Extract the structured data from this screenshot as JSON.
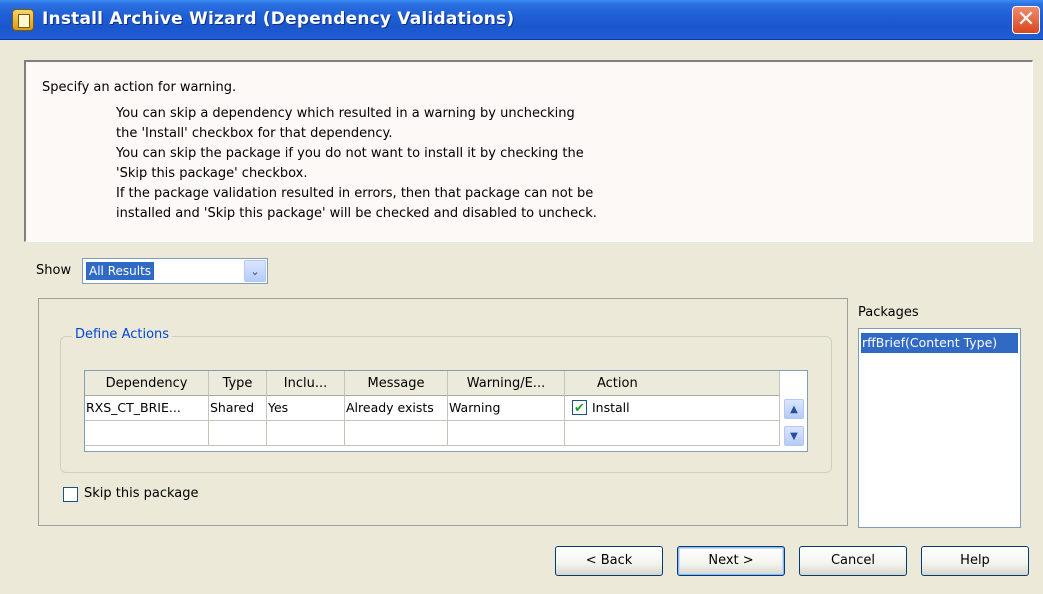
{
  "window": {
    "title": "Install Archive Wizard (Dependency Validations)",
    "close_glyph": "✕",
    "icon": "archive-wizard-icon"
  },
  "instructions": {
    "heading": "Specify an action for warning.",
    "lines": [
      "You can skip a dependency which resulted in a warning by unchecking",
      "the 'Install' checkbox for that dependency.",
      "You can skip the package if you do not want to install it by checking the",
      "'Skip this package' checkbox.",
      "If the package validation resulted in errors, then that package can not be",
      "installed and 'Skip this package' will be checked and disabled to uncheck."
    ]
  },
  "show": {
    "label": "Show",
    "selected": "All Results"
  },
  "define_actions": {
    "legend": "Define Actions",
    "columns": [
      "Dependency",
      "Type",
      "Inclu...",
      "Message",
      "Warning/E...",
      "Action"
    ],
    "rows": [
      {
        "dependency": "RXS_CT_BRIE...",
        "type": "Shared",
        "included": "Yes",
        "message": "Already exists",
        "warning": "Warning",
        "action_checked": true,
        "action_label": "Install"
      }
    ]
  },
  "skip_package": {
    "label": "Skip this package",
    "checked": false
  },
  "packages": {
    "label": "Packages",
    "items": [
      "rffBrief(Content Type)"
    ],
    "selected_index": 0
  },
  "buttons": {
    "back": "< Back",
    "next": "Next >",
    "cancel": "Cancel",
    "help": "Help"
  },
  "glyphs": {
    "chevron_down": "⌄",
    "scroll_up": "▲",
    "scroll_down": "▼",
    "check": "✔"
  },
  "colors": {
    "titlebar": "#1f5fd6",
    "selection": "#316ac5",
    "legend": "#0046d5",
    "close": "#d9461e"
  }
}
